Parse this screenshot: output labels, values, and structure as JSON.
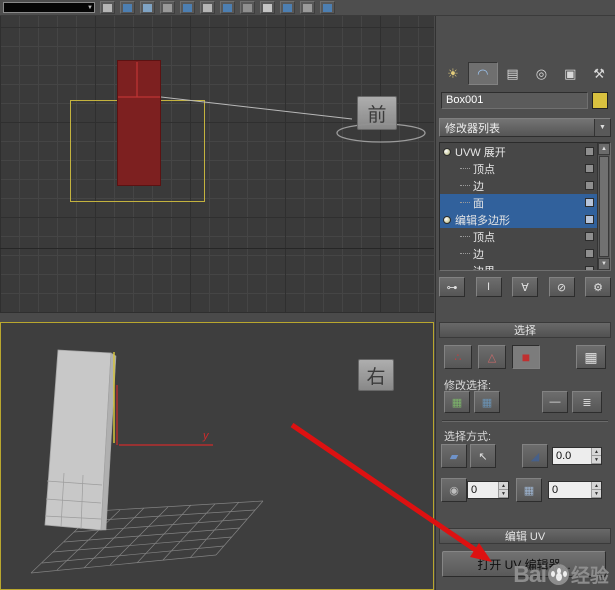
{
  "glyphs": {
    "up": "▲",
    "down": "▼",
    "caret": "▼"
  },
  "viewports": {
    "front": {
      "label": "前"
    },
    "right": {
      "label": "右",
      "axis_y": "y"
    }
  },
  "panel": {
    "tabs": [
      {
        "name": "create",
        "glyph": "☀"
      },
      {
        "name": "modify",
        "glyph": "◠"
      },
      {
        "name": "hierarchy",
        "glyph": "▤"
      },
      {
        "name": "motion",
        "glyph": "◎"
      },
      {
        "name": "display",
        "glyph": "▣"
      },
      {
        "name": "utilities",
        "glyph": "⚒"
      }
    ],
    "object_name": "Box001",
    "modifier_list_label": "修改器列表",
    "stack": [
      {
        "label": "UVW 展开"
      },
      {
        "label": "顶点"
      },
      {
        "label": "边"
      },
      {
        "label": "面"
      },
      {
        "label": "编辑多边形"
      },
      {
        "label": "顶点"
      },
      {
        "label": "边"
      },
      {
        "label": "边界"
      }
    ],
    "stack_buttons": [
      {
        "name": "pin-stack",
        "glyph": "⊶"
      },
      {
        "name": "show-end-result",
        "glyph": "I"
      },
      {
        "name": "make-unique",
        "glyph": "∀"
      },
      {
        "name": "remove-modifier",
        "glyph": "⊘"
      },
      {
        "name": "configure-modifier-sets",
        "glyph": "⚙"
      }
    ],
    "selection_rollout": {
      "title": "选择",
      "icons": {
        "vertex": "∴",
        "edge": "△",
        "face": "■",
        "element": "▦",
        "grow": "▦",
        "shrink": "▦",
        "dash": "—",
        "lines": "≣",
        "planar": "▰",
        "lasso": "↖",
        "cone": "◢",
        "sphere": "◉",
        "grid": "▦"
      },
      "modify_selection_label": "修改选择:",
      "selection_method_label": "选择方式:",
      "spinner_angle": "0.0",
      "spinner_a": "0",
      "spinner_b": "0"
    },
    "edit_uv_rollout": {
      "title": "编辑 UV",
      "open_editor_button": "打开 UV 编辑器..."
    }
  },
  "watermark": {
    "latin": "Bai",
    "cjk": "经验"
  },
  "colors": {
    "selection_blue": "#31619c",
    "box_red": "#7d2020",
    "arrow_red": "#dd1111",
    "swatch_yellow": "#d9c13f",
    "active_viewport_border": "#b9a72e"
  }
}
